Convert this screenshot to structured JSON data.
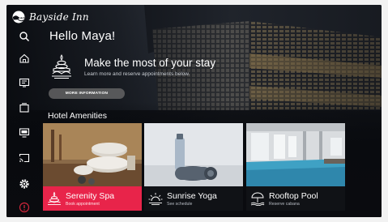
{
  "brand": {
    "name": "Bayside Inn"
  },
  "sidebar": {
    "items": [
      {
        "name": "search",
        "icon": "search-icon"
      },
      {
        "name": "home",
        "icon": "home-icon"
      },
      {
        "name": "tv-guide",
        "icon": "tv-guide-icon"
      },
      {
        "name": "apps",
        "icon": "apps-icon"
      },
      {
        "name": "inputs",
        "icon": "monitor-icon"
      },
      {
        "name": "cast",
        "icon": "cast-icon"
      },
      {
        "name": "settings",
        "icon": "gear-icon"
      },
      {
        "name": "info",
        "icon": "info-icon"
      }
    ]
  },
  "greeting": "Hello Maya!",
  "promo": {
    "title": "Make the most of your stay",
    "subtitle": "Learn more and reserve appointments below.",
    "button_label": "MORE INFORMATION",
    "icon": "spa-stones-icon"
  },
  "amenities": {
    "title": "Hotel Amenities",
    "cards": [
      {
        "title": "Serenity Spa",
        "subtitle": "Book appointment",
        "icon": "spa-icon",
        "band_color": "#e8244a",
        "subtitle_color": "#ffe1e6"
      },
      {
        "title": "Sunrise Yoga",
        "subtitle": "See schedule",
        "icon": "sunrise-icon",
        "band_color": "#101216",
        "subtitle_color": "#b7bcc4"
      },
      {
        "title": "Rooftop Pool",
        "subtitle": "Reserve cabana",
        "icon": "cabana-umbrella-icon",
        "band_color": "#101216",
        "subtitle_color": "#b7bcc4"
      }
    ]
  },
  "colors": {
    "accent": "#e8244a",
    "alert": "#d1263b",
    "background": "#0d0f14"
  }
}
